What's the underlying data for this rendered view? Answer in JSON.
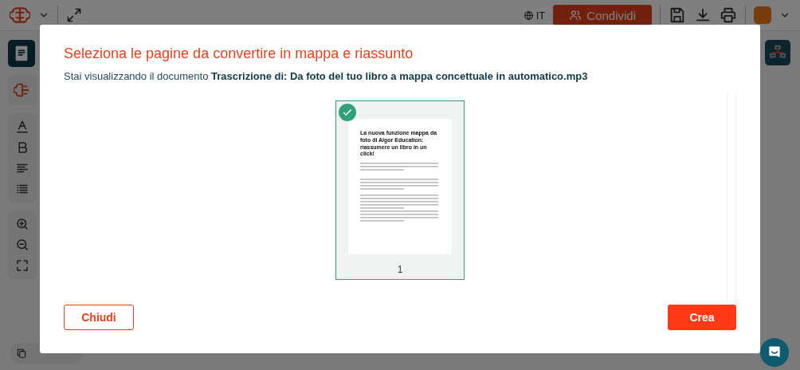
{
  "top_bar": {
    "language": "IT",
    "share_button": "Condividi"
  },
  "dialog": {
    "title": "Seleziona le pagine da convertire in mappa e riassunto",
    "subtitle": "Stai visualizzando il documento **Trascrizione di: Da foto del tuo libro a mappa concettuale in automatico.mp3**",
    "pages": [
      {
        "number": "1",
        "heading": "La nuova funzione mappa da foto di Algor Education: riassumere un libro in un click!",
        "selected": true
      }
    ],
    "buttons": [
      {
        "kind": "secondary",
        "label": "Chiudi"
      },
      {
        "kind": "primary",
        "label": "Crea"
      }
    ]
  }
}
